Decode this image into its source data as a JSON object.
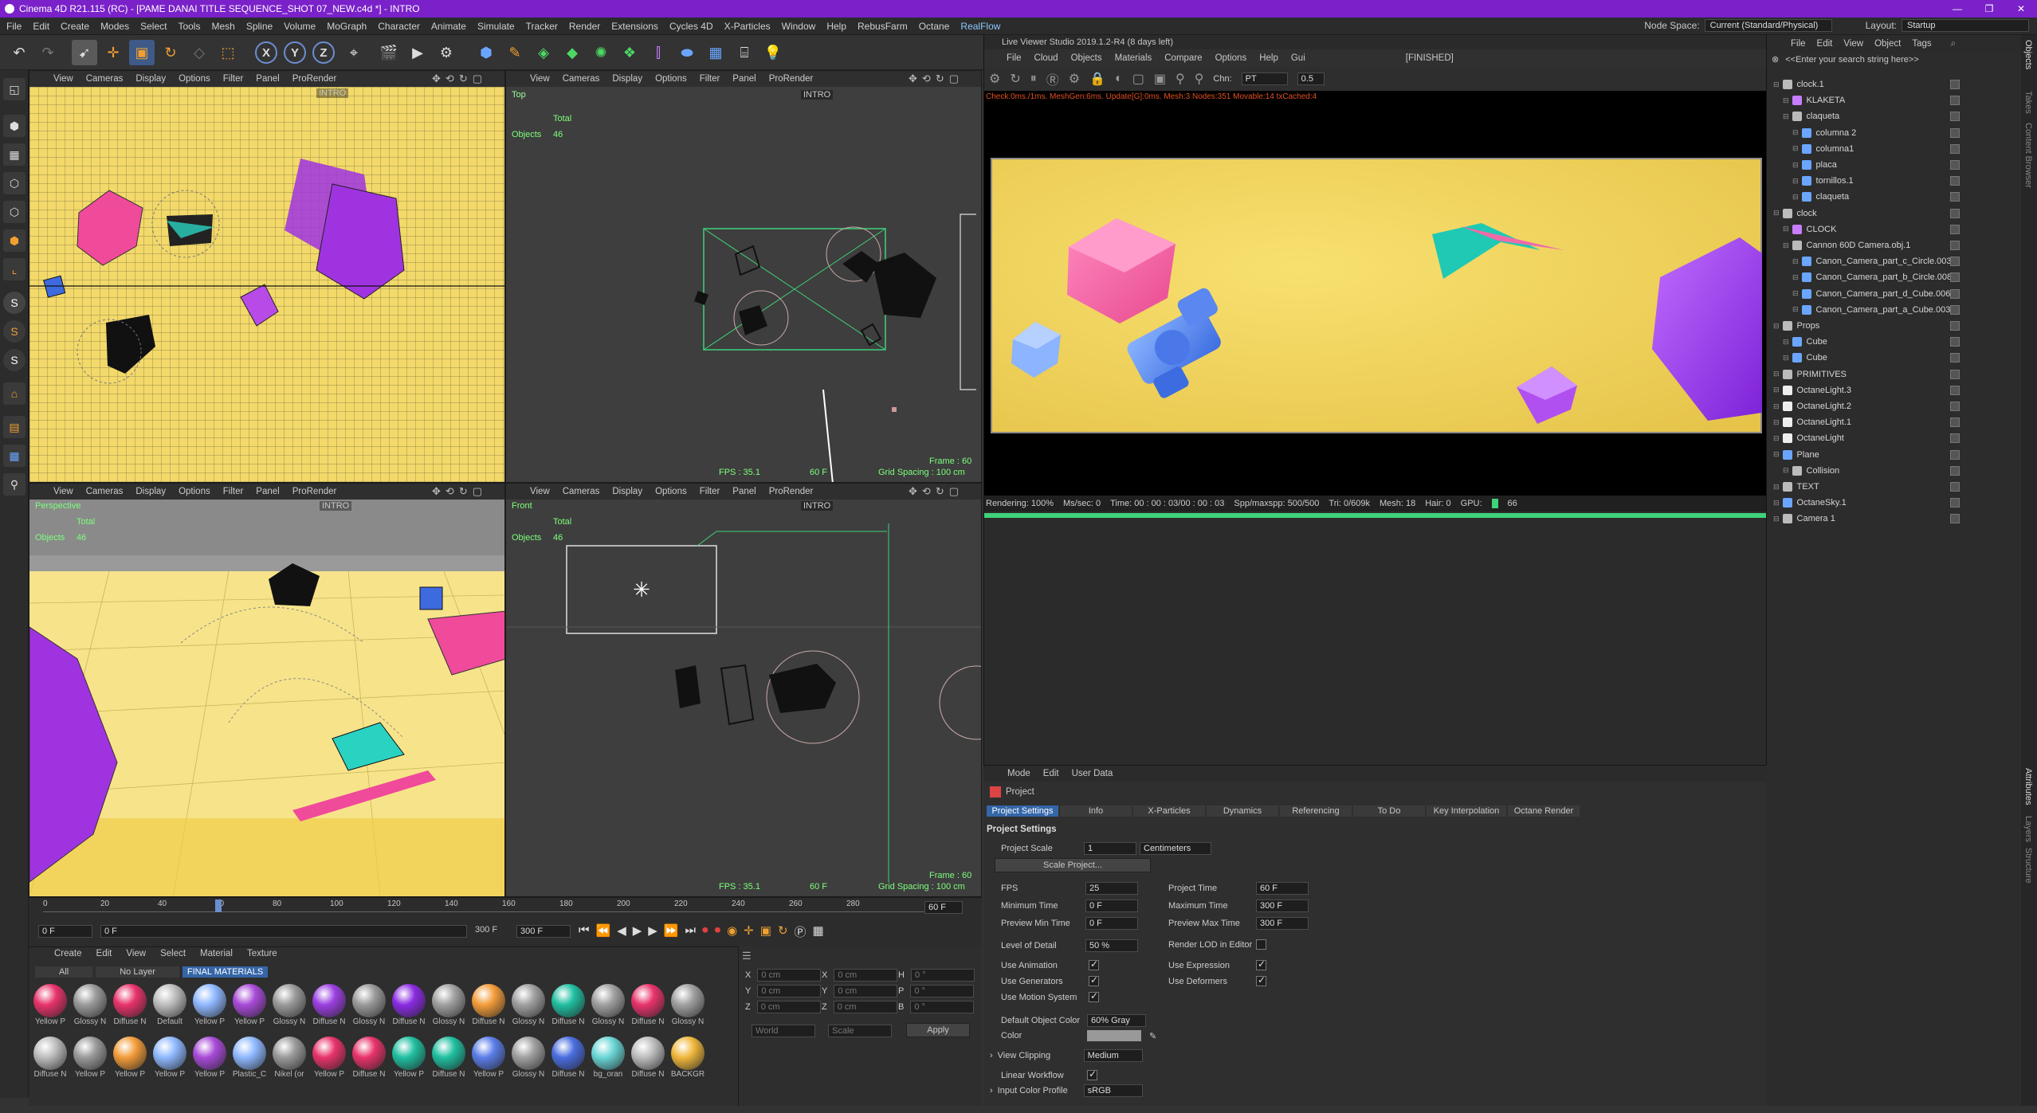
{
  "window": {
    "title": "Cinema 4D R21.115 (RC) - [PAME DANAI TITLE SEQUENCE_SHOT 07_NEW.c4d *] - INTRO"
  },
  "menu": [
    "File",
    "Edit",
    "Create",
    "Modes",
    "Select",
    "Tools",
    "Mesh",
    "Spline",
    "Volume",
    "MoGraph",
    "Character",
    "Animate",
    "Simulate",
    "Tracker",
    "Render",
    "Extensions",
    "Cycles 4D",
    "X-Particles",
    "Window",
    "Help",
    "RebusFarm",
    "Octane"
  ],
  "menu_highlight": "RealFlow",
  "node_space": {
    "label": "Node Space:",
    "value": "Current (Standard/Physical)"
  },
  "layout": {
    "label": "Layout:",
    "value": "Startup"
  },
  "viewport_menu": {
    "view": "View",
    "cameras": "Cameras",
    "display": "Display",
    "options": "Options",
    "filter": "Filter",
    "panel": "Panel",
    "prorender": "ProRender"
  },
  "viewports": {
    "tl": {
      "camera": "INTRO"
    },
    "tr": {
      "name": "Top",
      "camera": "INTRO",
      "total": "Total",
      "objects": "Objects",
      "objects_count": "46",
      "fps": "FPS : 35.1",
      "frame_sel": "60 F",
      "frame": "Frame : 60",
      "grid": "Grid Spacing : 100 cm"
    },
    "bl": {
      "name": "Perspective",
      "camera": "INTRO",
      "total": "Total",
      "objects": "Objects",
      "objects_count": "46"
    },
    "br": {
      "name": "Front",
      "camera": "INTRO",
      "total": "Total",
      "objects": "Objects",
      "objects_count": "46",
      "fps": "FPS : 35.1",
      "frame_sel": "60 F",
      "frame": "Frame : 60",
      "grid": "Grid Spacing : 100 cm"
    }
  },
  "timeline": {
    "ticks": [
      "0",
      "20",
      "40",
      "60",
      "80",
      "100",
      "120",
      "140",
      "160",
      "180",
      "200",
      "220",
      "240",
      "260",
      "280"
    ],
    "current": "60 F",
    "start": "0 F",
    "start2": "0 F",
    "end": "300 F",
    "end2": "300 F"
  },
  "materials": {
    "menu": [
      "Create",
      "Edit",
      "View",
      "Select",
      "Material",
      "Texture"
    ],
    "tabs": [
      "All",
      "No Layer",
      "FINAL MATERIALS"
    ],
    "row1": [
      {
        "label": "Yellow P",
        "color": "#e8336b"
      },
      {
        "label": "Glossy N",
        "color": "#9a9a9a"
      },
      {
        "label": "Diffuse N",
        "color": "#e8336b"
      },
      {
        "label": "Default",
        "color": "#bdbdbd"
      },
      {
        "label": "Yellow P",
        "color": "#8fb8ff"
      },
      {
        "label": "Yellow P",
        "color": "#a84ad8"
      },
      {
        "label": "Glossy N",
        "color": "#9a9a9a"
      },
      {
        "label": "Diffuse N",
        "color": "#9b3fe0"
      },
      {
        "label": "Glossy N",
        "color": "#9a9a9a"
      },
      {
        "label": "Diffuse N",
        "color": "#8a2be2"
      },
      {
        "label": "Glossy N",
        "color": "#a0a0a0"
      },
      {
        "label": "Diffuse N",
        "color": "#f39c3a"
      },
      {
        "label": "Glossy N",
        "color": "#a0a0a0"
      },
      {
        "label": "Diffuse N",
        "color": "#1fbfa0"
      },
      {
        "label": "Glossy N",
        "color": "#a0a0a0"
      },
      {
        "label": "Diffuse N",
        "color": "#e8336b"
      },
      {
        "label": "Glossy N",
        "color": "#a0a0a0"
      }
    ],
    "row2": [
      {
        "label": "Diffuse N",
        "color": "#bdbdbd"
      },
      {
        "label": "Yellow P",
        "color": "#9a9a9a"
      },
      {
        "label": "Yellow P",
        "color": "#f39c3a"
      },
      {
        "label": "Yellow P",
        "color": "#8fb8ff"
      },
      {
        "label": "Yellow P",
        "color": "#a84ad8"
      },
      {
        "label": "Plastic_C",
        "color": "#8fb8ff"
      },
      {
        "label": "Nikel (or",
        "color": "#9a9a9a"
      },
      {
        "label": "Yellow P",
        "color": "#e8336b"
      },
      {
        "label": "Diffuse N",
        "color": "#e8336b"
      },
      {
        "label": "Yellow P",
        "color": "#1fbfa0"
      },
      {
        "label": "Diffuse N",
        "color": "#1fbfa0"
      },
      {
        "label": "Yellow P",
        "color": "#5b7de8"
      },
      {
        "label": "Glossy N",
        "color": "#a0a0a0"
      },
      {
        "label": "Diffuse N",
        "color": "#4a6de0"
      },
      {
        "label": "bg_oran",
        "color": "#6ad6d6"
      },
      {
        "label": "Diffuse N",
        "color": "#bdbdbd"
      },
      {
        "label": "BACKGR",
        "color": "#f0b83c"
      }
    ]
  },
  "coords": {
    "x": "0 cm",
    "y": "0 cm",
    "z": "0 cm",
    "x2": "0 cm",
    "y2": "0 cm",
    "z2": "0 cm",
    "h": "0 °",
    "p": "0 °",
    "b": "0 °",
    "mode1": "World",
    "mode2": "Scale",
    "apply": "Apply"
  },
  "live_viewer": {
    "title": "Live Viewer Studio 2019.1.2-R4 (8 days left)",
    "menu": [
      "File",
      "Cloud",
      "Objects",
      "Materials",
      "Compare",
      "Options",
      "Help",
      "Gui"
    ],
    "status": "[FINISHED]",
    "chn_label": "Chn:",
    "chn": "PT",
    "chn_val": "0.5",
    "check": "Check:0ms./1ms. MeshGen:6ms. Update[G]:0ms. Mesh:3 Nodes:351 Movable:14 txCached:4",
    "render_stats": {
      "rendering": "Rendering: 100%",
      "mssec": "Ms/sec: 0",
      "time": "Time: 00 : 00 : 03/00 : 00 : 03",
      "spp": "Spp/maxspp: 500/500",
      "tri": "Tri: 0/609k",
      "mesh": "Mesh: 18",
      "hair": "Hair: 0",
      "gpu": "GPU:",
      "gpu_val": "66"
    }
  },
  "attributes": {
    "menu": [
      "Mode",
      "Edit",
      "User Data"
    ],
    "object": "Project",
    "tabs": [
      "Project Settings",
      "Info",
      "X-Particles",
      "Dynamics",
      "Referencing",
      "To Do",
      "Key Interpolation",
      "Octane Render"
    ],
    "section": "Project Settings",
    "project_scale_label": "Project Scale",
    "project_scale": "1",
    "project_scale_unit": "Centimeters",
    "scale_button": "Scale Project...",
    "fps_label": "FPS",
    "fps": "25",
    "project_time_label": "Project Time",
    "project_time": "60 F",
    "min_time_label": "Minimum Time",
    "min_time": "0 F",
    "max_time_label": "Maximum Time",
    "max_time": "300 F",
    "prev_min_label": "Preview Min Time",
    "prev_min": "0 F",
    "prev_max_label": "Preview Max Time",
    "prev_max": "300 F",
    "lod_label": "Level of Detail",
    "lod": "50 %",
    "render_lod_label": "Render LOD in Editor",
    "use_anim": "Use Animation",
    "use_expr": "Use Expression",
    "use_gen": "Use Generators",
    "use_deform": "Use Deformers",
    "use_motion": "Use Motion System",
    "def_color_label": "Default Object Color",
    "def_color": "60% Gray",
    "color_label": "Color",
    "clipping_label": "View Clipping",
    "clipping": "Medium",
    "linear_label": "Linear Workflow",
    "input_profile_label": "Input Color Profile",
    "input_profile": "sRGB"
  },
  "objects": {
    "menu": [
      "File",
      "Edit",
      "View",
      "Object",
      "Tags"
    ],
    "search": "<<Enter your search string here>>",
    "items": [
      {
        "name": "clock.1",
        "indent": 0,
        "color": "#bbb"
      },
      {
        "name": "KLAKETA",
        "indent": 1,
        "color": "#c77dff"
      },
      {
        "name": "claqueta",
        "indent": 1,
        "color": "#bbb"
      },
      {
        "name": "columna 2",
        "indent": 2,
        "color": "#6aa6ff"
      },
      {
        "name": "columna1",
        "indent": 2,
        "color": "#6aa6ff"
      },
      {
        "name": "placa",
        "indent": 2,
        "color": "#6aa6ff"
      },
      {
        "name": "tornillos.1",
        "indent": 2,
        "color": "#6aa6ff"
      },
      {
        "name": "claqueta",
        "indent": 2,
        "color": "#6aa6ff"
      },
      {
        "name": "clock",
        "indent": 0,
        "color": "#bbb"
      },
      {
        "name": "CLOCK",
        "indent": 1,
        "color": "#c77dff"
      },
      {
        "name": "Cannon 60D Camera.obj.1",
        "indent": 1,
        "color": "#bbb"
      },
      {
        "name": "Canon_Camera_part_c_Circle.003",
        "indent": 2,
        "color": "#6aa6ff"
      },
      {
        "name": "Canon_Camera_part_b_Circle.008",
        "indent": 2,
        "color": "#6aa6ff"
      },
      {
        "name": "Canon_Camera_part_d_Cube.006",
        "indent": 2,
        "color": "#6aa6ff"
      },
      {
        "name": "Canon_Camera_part_a_Cube.003",
        "indent": 2,
        "color": "#6aa6ff"
      },
      {
        "name": "Props",
        "indent": 0,
        "color": "#bbb"
      },
      {
        "name": "Cube",
        "indent": 1,
        "color": "#6aa6ff"
      },
      {
        "name": "Cube",
        "indent": 1,
        "color": "#6aa6ff"
      },
      {
        "name": "PRIMITIVES",
        "indent": 0,
        "color": "#bbb"
      },
      {
        "name": "OctaneLight.3",
        "indent": 0,
        "color": "#eee"
      },
      {
        "name": "OctaneLight.2",
        "indent": 0,
        "color": "#eee"
      },
      {
        "name": "OctaneLight.1",
        "indent": 0,
        "color": "#eee"
      },
      {
        "name": "OctaneLight",
        "indent": 0,
        "color": "#eee"
      },
      {
        "name": "Plane",
        "indent": 0,
        "color": "#6aa6ff"
      },
      {
        "name": "Collision",
        "indent": 1,
        "color": "#bbb"
      },
      {
        "name": "TEXT",
        "indent": 0,
        "color": "#bbb"
      },
      {
        "name": "OctaneSky.1",
        "indent": 0,
        "color": "#6aa6ff"
      },
      {
        "name": "Camera 1",
        "indent": 0,
        "color": "#bbb"
      }
    ]
  },
  "side_tabs": {
    "objects": "Objects",
    "takes": "Takes",
    "content": "Content Browser",
    "attributes": "Attributes",
    "layers": "Layers",
    "structure": "Structure"
  }
}
